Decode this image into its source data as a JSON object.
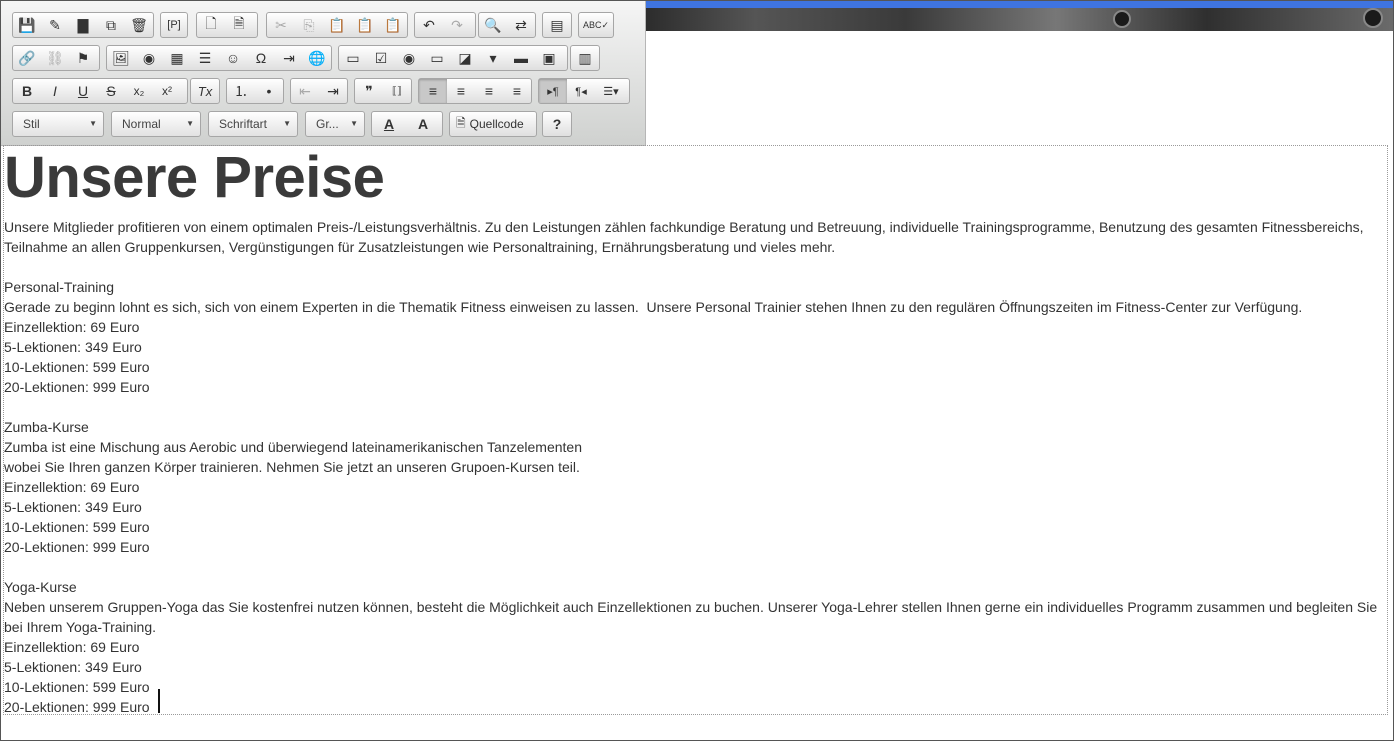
{
  "toolbar": {
    "row1": [
      {
        "name": "save-icon",
        "glyph": "💾"
      },
      {
        "name": "wand-icon",
        "glyph": "✎"
      },
      {
        "name": "folder-icon",
        "glyph": "▇"
      },
      {
        "name": "copy-doc-icon",
        "glyph": "⧉"
      },
      {
        "name": "trash-icon",
        "glyph": "🗑"
      },
      {
        "name": "placeholder-icon",
        "glyph": "[P]"
      },
      {
        "name": "new-page-icon",
        "glyph": "🗋"
      },
      {
        "name": "template-icon",
        "glyph": "🗎"
      },
      {
        "name": "cut-icon",
        "glyph": "✂"
      },
      {
        "name": "copy-icon",
        "glyph": "⎘"
      },
      {
        "name": "paste-icon",
        "glyph": "📋"
      },
      {
        "name": "paste-text-icon",
        "glyph": "📋"
      },
      {
        "name": "paste-word-icon",
        "glyph": "📋"
      },
      {
        "name": "undo-icon",
        "glyph": "↶"
      },
      {
        "name": "redo-icon",
        "glyph": "↷"
      },
      {
        "name": "find-icon",
        "glyph": "🔍"
      },
      {
        "name": "replace-icon",
        "glyph": "⇄"
      },
      {
        "name": "select-all-icon",
        "glyph": "▤"
      },
      {
        "name": "spellcheck-icon",
        "glyph": "ABC✓"
      }
    ],
    "row2": [
      {
        "name": "link-icon",
        "glyph": "🔗"
      },
      {
        "name": "unlink-icon",
        "glyph": "⛓"
      },
      {
        "name": "anchor-flag-icon",
        "glyph": "⚑"
      },
      {
        "name": "image-icon",
        "glyph": "🖼"
      },
      {
        "name": "flash-icon",
        "glyph": "◉"
      },
      {
        "name": "table-icon",
        "glyph": "▦"
      },
      {
        "name": "horizontal-line-icon",
        "glyph": "☰"
      },
      {
        "name": "smiley-icon",
        "glyph": "☺"
      },
      {
        "name": "special-char-icon",
        "glyph": "Ω"
      },
      {
        "name": "page-break-icon",
        "glyph": "⇥"
      },
      {
        "name": "iframe-icon",
        "glyph": "🌐"
      },
      {
        "name": "form-icon",
        "glyph": "▭"
      },
      {
        "name": "checkbox-icon",
        "glyph": "☑"
      },
      {
        "name": "radio-icon",
        "glyph": "◉"
      },
      {
        "name": "text-field-icon",
        "glyph": "▭"
      },
      {
        "name": "textarea-icon",
        "glyph": "◪"
      },
      {
        "name": "select-field-icon",
        "glyph": "▾"
      },
      {
        "name": "button-field-icon",
        "glyph": "▬"
      },
      {
        "name": "image-button-icon",
        "glyph": "▣"
      },
      {
        "name": "hidden-field-icon",
        "glyph": "▥"
      }
    ],
    "row3": [
      {
        "name": "bold-icon",
        "glyph": "B"
      },
      {
        "name": "italic-icon",
        "glyph": "I"
      },
      {
        "name": "underline-icon",
        "glyph": "U"
      },
      {
        "name": "strike-icon",
        "glyph": "S"
      },
      {
        "name": "subscript-icon",
        "glyph": "x₂"
      },
      {
        "name": "superscript-icon",
        "glyph": "x²"
      },
      {
        "name": "remove-format-icon",
        "glyph": "Tx"
      },
      {
        "name": "numbered-list-icon",
        "glyph": "⒈"
      },
      {
        "name": "bullet-list-icon",
        "glyph": "•"
      },
      {
        "name": "outdent-icon",
        "glyph": "⇤"
      },
      {
        "name": "indent-icon",
        "glyph": "⇥"
      },
      {
        "name": "blockquote-icon",
        "glyph": "❞"
      },
      {
        "name": "div-icon",
        "glyph": "⟦⟧"
      },
      {
        "name": "align-left-icon",
        "glyph": "≡"
      },
      {
        "name": "align-center-icon",
        "glyph": "≡"
      },
      {
        "name": "align-right-icon",
        "glyph": "≡"
      },
      {
        "name": "align-justify-icon",
        "glyph": "≡"
      },
      {
        "name": "ltr-icon",
        "glyph": "▸¶"
      },
      {
        "name": "rtl-icon",
        "glyph": "¶◂"
      },
      {
        "name": "language-icon",
        "glyph": "☰▾"
      }
    ],
    "style_combo": "Stil",
    "format_combo": "Normal",
    "font_combo": "Schriftart",
    "size_combo": "Gr...",
    "text_color_icon": "A",
    "bg_color_icon": "A",
    "source_label": "Quellcode",
    "help_icon": "?"
  },
  "editor": {
    "title": "Unsere Preise",
    "paragraphs": [
      "Unsere Mitglieder profitieren von einem optimalen Preis-/Leistungsverhältnis. Zu den Leistungen zählen fachkundige Beratung und Betreuung, individuelle Trainingsprogramme, Benutzung des gesamten Fitnessbereichs, Teilnahme an allen Gruppenkursen, Vergünstigungen für Zusatzleistungen wie Personaltraining, Ernährungsberatung und vieles mehr.",
      "",
      "Personal-Training",
      "Gerade zu beginn lohnt es sich, sich von einem Experten in die Thematik Fitness einweisen zu lassen.  Unsere Personal Trainier stehen Ihnen zu den regulären Öffnungszeiten im Fitness-Center zur Verfügung.",
      "Einzellektion: 69 Euro",
      "5-Lektionen: 349 Euro",
      "10-Lektionen: 599 Euro",
      "20-Lektionen: 999 Euro",
      "",
      "Zumba-Kurse",
      "Zumba ist eine Mischung aus Aerobic und überwiegend lateinamerikanischen Tanzelementen",
      "wobei Sie Ihren ganzen Körper trainieren. Nehmen Sie jetzt an unseren Grupoen-Kursen teil.",
      "Einzellektion: 69 Euro",
      "5-Lektionen: 349 Euro",
      "10-Lektionen: 599 Euro",
      "20-Lektionen: 999 Euro",
      "",
      "Yoga-Kurse",
      "Neben unserem Gruppen-Yoga das Sie kostenfrei nutzen können, besteht die Möglichkeit auch Einzellektionen zu buchen. Unserer Yoga-Lehrer stellen Ihnen gerne ein individuelles Programm zusammen und begleiten Sie bei Ihrem Yoga-Training.",
      "Einzellektion: 69 Euro",
      "5-Lektionen: 349 Euro",
      "10-Lektionen: 599 Euro",
      "20-Lektionen: 999 Euro"
    ]
  },
  "colors": {
    "accent": "#3f74e0",
    "toolbar_top": "#f5f5f5",
    "toolbar_bottom": "#cfd1cf",
    "text": "#333333"
  }
}
